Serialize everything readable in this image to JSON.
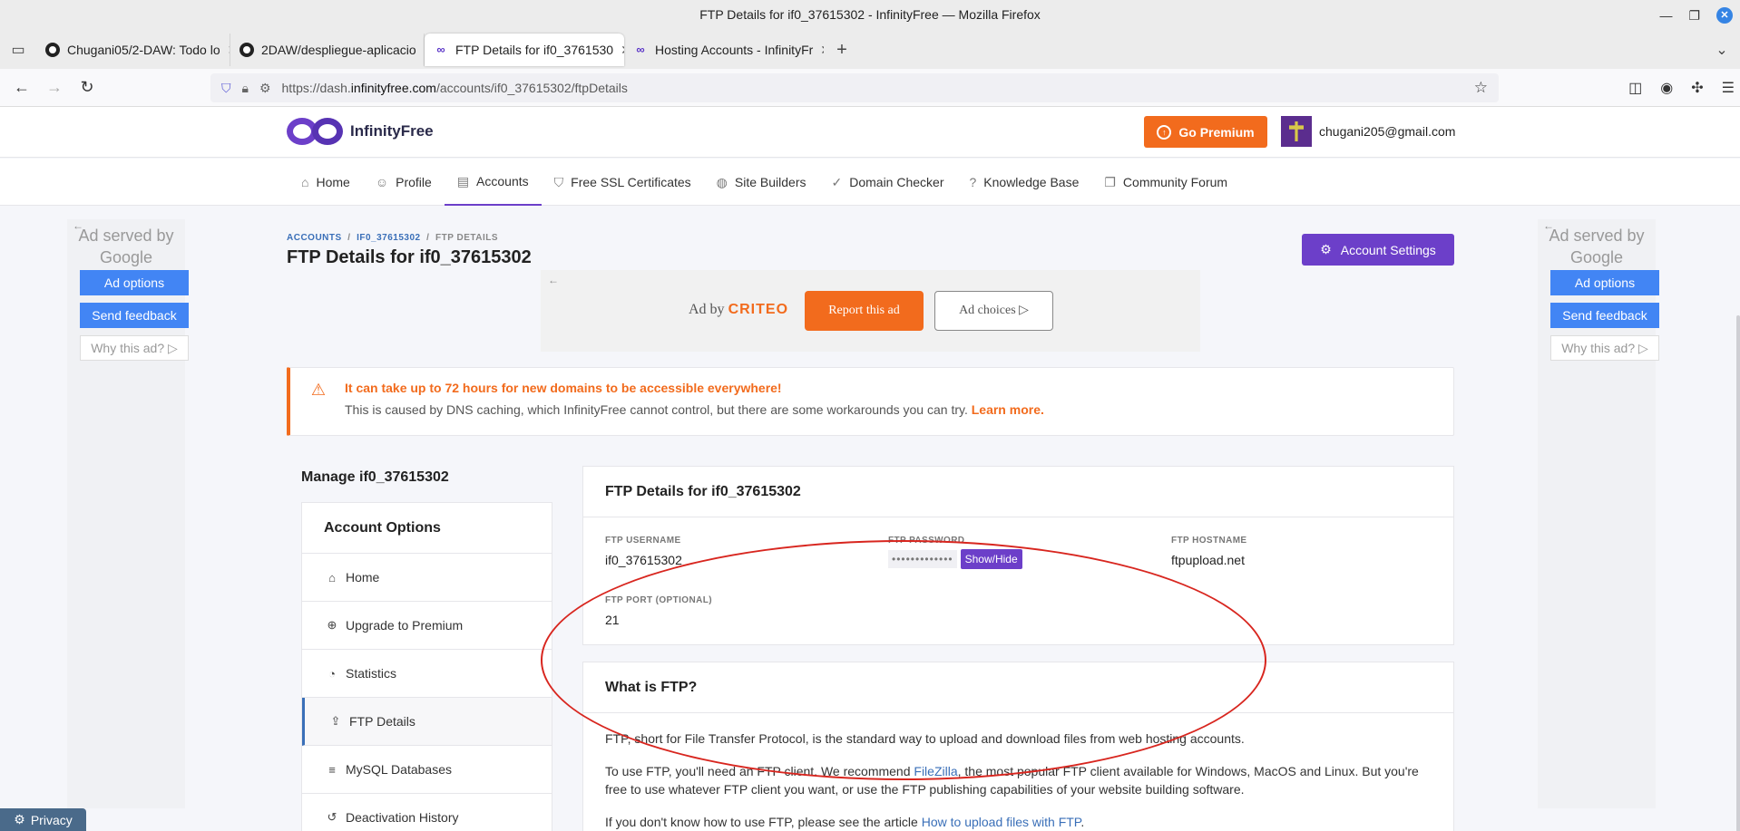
{
  "window": {
    "title": "FTP Details for if0_37615302 - InfinityFree — Mozilla Firefox"
  },
  "tabs": [
    {
      "label": "Chugani05/2-DAW: Todo lo",
      "favicon": "github-icon"
    },
    {
      "label": "2DAW/despliegue-aplicacio",
      "favicon": "github-icon"
    },
    {
      "label": "FTP Details for if0_3761530",
      "favicon": "infinityfree-icon"
    },
    {
      "label": "Hosting Accounts - InfinityFr",
      "favicon": "infinityfree-icon"
    }
  ],
  "browser": {
    "url_prefix": "https://dash.",
    "url_domain": "infinityfree.com",
    "url_path": "/accounts/if0_37615302/ftpDetails"
  },
  "header": {
    "brand": "InfinityFree",
    "premium_label": "Go Premium",
    "user_email": "chugani205@gmail.com"
  },
  "nav": [
    {
      "label": "Home",
      "icon": "home-icon"
    },
    {
      "label": "Profile",
      "icon": "user-icon"
    },
    {
      "label": "Accounts",
      "icon": "server-icon"
    },
    {
      "label": "Free SSL Certificates",
      "icon": "shield-icon"
    },
    {
      "label": "Site Builders",
      "icon": "palette-icon"
    },
    {
      "label": "Domain Checker",
      "icon": "check-circle-icon"
    },
    {
      "label": "Knowledge Base",
      "icon": "question-icon"
    },
    {
      "label": "Community Forum",
      "icon": "chat-icon"
    }
  ],
  "breadcrumb": {
    "root": "ACCOUNTS",
    "account": "IF0_37615302",
    "current": "FTP DETAILS"
  },
  "page_title": "FTP Details for if0_37615302",
  "account_settings_label": "Account Settings",
  "side_ad": {
    "served_by": "Ad served by",
    "google": "Google",
    "options": "Ad options",
    "feedback": "Send feedback",
    "why": "Why this ad? ▷"
  },
  "center_ad": {
    "adby": "Ad by",
    "brand": "CRITEO",
    "report": "Report this ad",
    "choices": "Ad choices ▷"
  },
  "alert": {
    "title": "It can take up to 72 hours for new domains to be accessible everywhere!",
    "body": "This is caused by DNS caching, which InfinityFree cannot control, but there are some workarounds you can try.",
    "link": "Learn more."
  },
  "manage_title": "Manage if0_37615302",
  "side_menu": {
    "head": "Account Options",
    "items": [
      {
        "label": "Home",
        "icon": "home-icon"
      },
      {
        "label": "Upgrade to Premium",
        "icon": "arrow-up-circle-icon"
      },
      {
        "label": "Statistics",
        "icon": "pie-chart-icon"
      },
      {
        "label": "FTP Details",
        "icon": "file-upload-icon"
      },
      {
        "label": "MySQL Databases",
        "icon": "database-icon"
      },
      {
        "label": "Deactivation History",
        "icon": "history-icon"
      }
    ]
  },
  "ftp": {
    "title": "FTP Details for if0_37615302",
    "username_label": "FTP USERNAME",
    "username": "if0_37615302",
    "password_label": "FTP PASSWORD",
    "password_mask": "•••••••••••••",
    "show_hide": "Show/Hide",
    "hostname_label": "FTP HOSTNAME",
    "hostname": "ftpupload.net",
    "port_label": "FTP PORT (OPTIONAL)",
    "port": "21"
  },
  "what_ftp": {
    "title": "What is FTP?",
    "p1": "FTP, short for File Transfer Protocol, is the standard way to upload and download files from web hosting accounts.",
    "p2a": "To use FTP, you'll need an FTP client. We recommend",
    "p2link": "FileZilla",
    "p2b": ", the most popular FTP client available for Windows, MacOS and Linux. But you're free to use whatever FTP client you want, or use the FTP publishing capabilities of your website building software.",
    "p3a": "If you don't know how to use FTP, please see the article",
    "p3link": "How to upload files with FTP",
    "p3b": "."
  },
  "privacy_label": "Privacy",
  "colors": {
    "brand_purple": "#6c3fc9",
    "premium_orange": "#f26b1d",
    "annotation_red": "#d8261f"
  }
}
